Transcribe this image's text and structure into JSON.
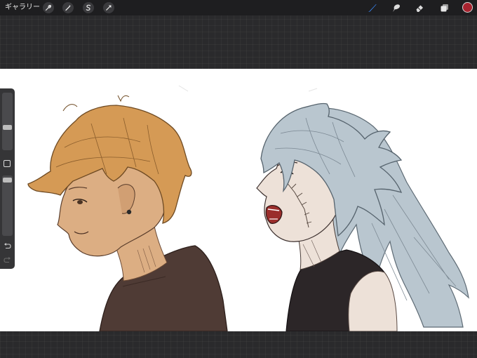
{
  "topbar": {
    "gallery_label": "ギャラリー",
    "actions": [
      {
        "name": "wrench-icon"
      },
      {
        "name": "magic-wand-icon"
      },
      {
        "name": "selection-s-icon"
      },
      {
        "name": "transform-arrow-icon"
      }
    ],
    "tools": [
      {
        "name": "brush-tool-icon",
        "active": true
      },
      {
        "name": "smudge-tool-icon",
        "active": false
      },
      {
        "name": "eraser-tool-icon",
        "active": false
      },
      {
        "name": "layers-icon",
        "active": false
      }
    ],
    "current_color": "#a7232f",
    "active_tool_color": "#3b8cff"
  },
  "sidebar": {
    "brush_size_level": 0.35,
    "opacity_level": 0.08,
    "modify_button": "square-modify-icon",
    "undo": "undo-icon",
    "redo": "redo-icon"
  },
  "canvas": {
    "background": "#ffffff",
    "subjects": [
      {
        "name": "blond-man-profile",
        "hair": "#d59a55",
        "skin": "#dcae83",
        "shirt": "#4f3b35"
      },
      {
        "name": "silver-haired-man-profile",
        "hair": "#b9c6cf",
        "skin": "#ede1d8",
        "shirt": "#2c2628"
      }
    ]
  }
}
